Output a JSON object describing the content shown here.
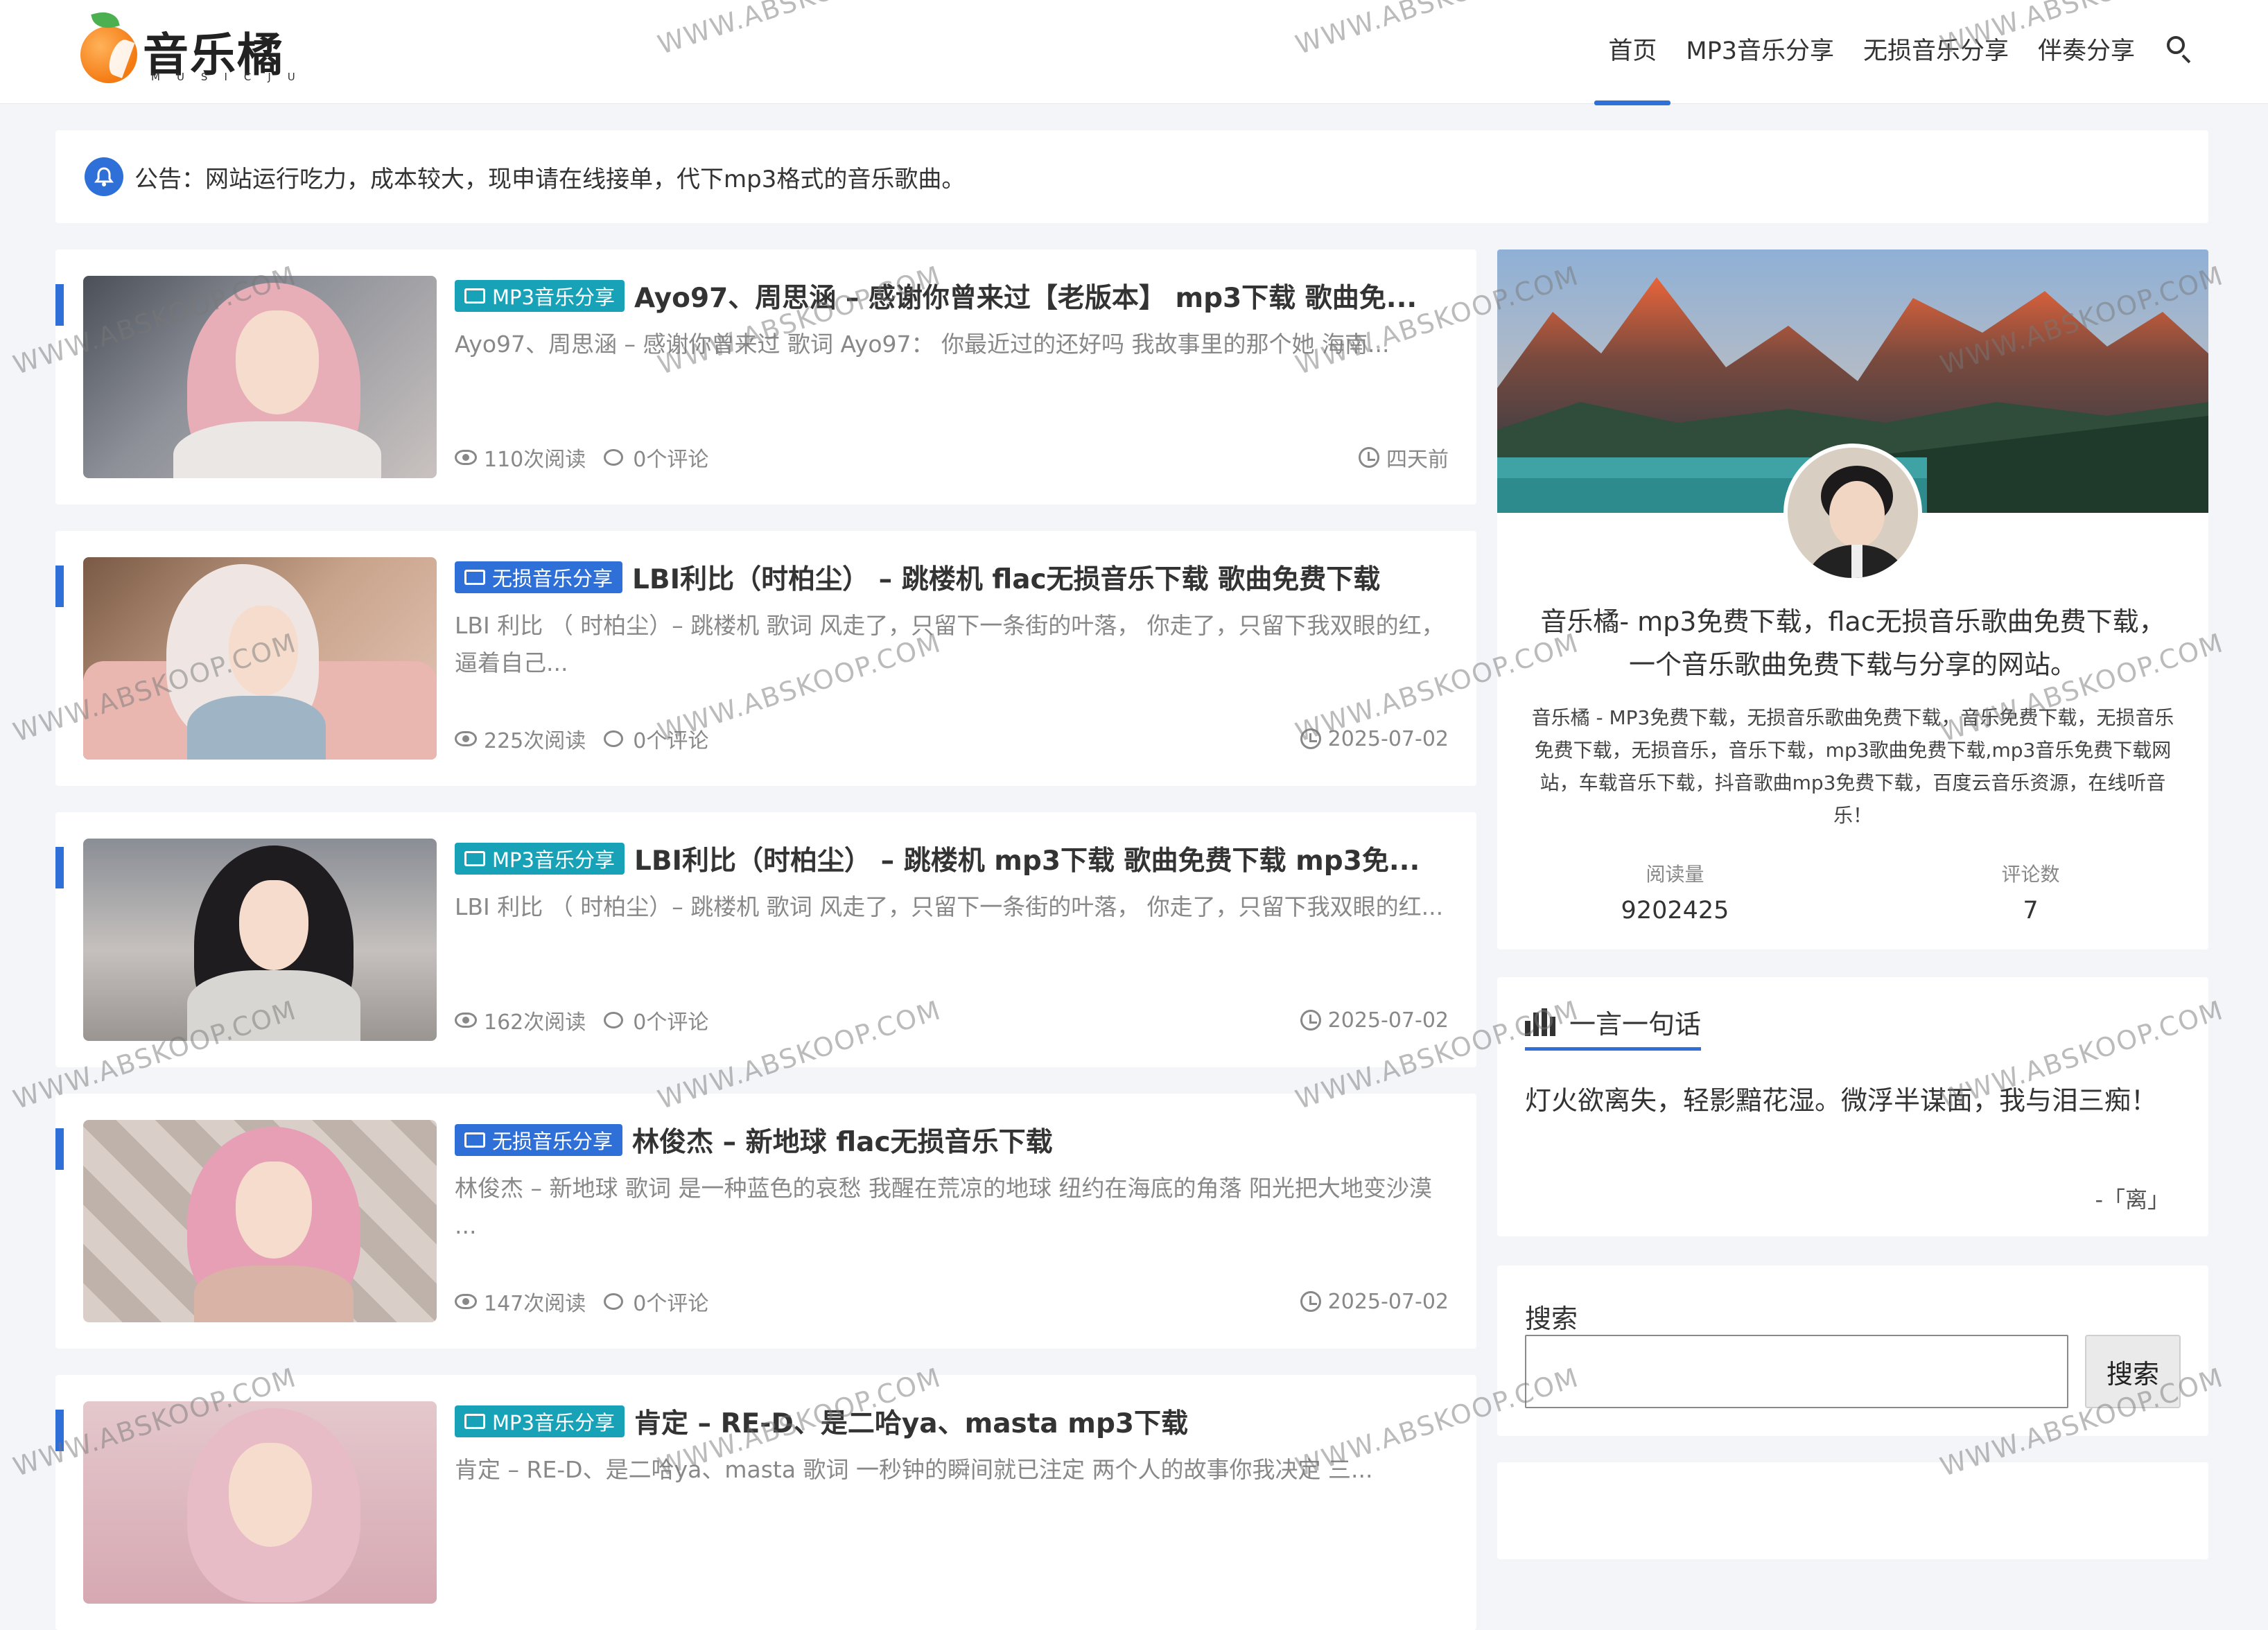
{
  "header": {
    "logo_text": "音乐橘",
    "logo_sub": "MUSICJU",
    "nav": [
      "首页",
      "MP3音乐分享",
      "无损音乐分享",
      "伴奏分享"
    ]
  },
  "notice": {
    "text": "公告：网站运行吃力，成本较大，现申请在线接单，代下mp3格式的音乐歌曲。"
  },
  "posts": [
    {
      "category": "MP3音乐分享",
      "title": "Ayo97、周思涵 – 感谢你曾来过【老版本】 mp3下载 歌曲免...",
      "excerpt": "Ayo97、周思涵 – 感谢你曾来过 歌词 Ayo97： 你最近过的还好吗 我故事里的那个她 海南...",
      "views": "110次阅读",
      "comments": "0个评论",
      "time": "四天前"
    },
    {
      "category": "无损音乐分享",
      "title": "LBI利比（时柏尘） – 跳楼机 flac无损音乐下载 歌曲免费下载",
      "excerpt": "LBI 利比 （ 时柏尘）– 跳楼机 歌词 风走了，只留下一条街的叶落， 你走了，只留下我双眼的红， 逼着自己...",
      "views": "225次阅读",
      "comments": "0个评论",
      "time": "2025-07-02"
    },
    {
      "category": "MP3音乐分享",
      "title": "LBI利比（时柏尘） – 跳楼机 mp3下载 歌曲免费下载 mp3免...",
      "excerpt": "LBI 利比 （ 时柏尘）– 跳楼机 歌词 风走了，只留下一条街的叶落， 你走了，只留下我双眼的红...",
      "views": "162次阅读",
      "comments": "0个评论",
      "time": "2025-07-02"
    },
    {
      "category": "无损音乐分享",
      "title": "林俊杰 – 新地球 flac无损音乐下载",
      "excerpt": "林俊杰 – 新地球 歌词 是一种蓝色的哀愁 我醒在荒凉的地球 纽约在海底的角落 阳光把大地变沙漠 ...",
      "views": "147次阅读",
      "comments": "0个评论",
      "time": "2025-07-02"
    },
    {
      "category": "MP3音乐分享",
      "title": "肯定 – RE-D、是二哈ya、masta mp3下载",
      "excerpt": "肯定 – RE-D、是二哈ya、masta 歌词 一秒钟的瞬间就已注定 两个人的故事你我决定 三...",
      "views": "",
      "comments": "",
      "time": ""
    }
  ],
  "profile": {
    "title": "音乐橘- mp3免费下载，flac无损音乐歌曲免费下载，一个音乐歌曲免费下载与分享的网站。",
    "description": "音乐橘 - MP3免费下载，无损音乐歌曲免费下载，音乐免费下载，无损音乐免费下载，无损音乐，音乐下载，mp3歌曲免费下载,mp3音乐免费下载网站，车载音乐下载，抖音歌曲mp3免费下载，百度云音乐资源，在线听音乐！",
    "stats": [
      {
        "label": "阅读量",
        "value": "9202425"
      },
      {
        "label": "评论数",
        "value": "7"
      }
    ]
  },
  "quote": {
    "title": "一言一句话",
    "text": "灯火欲离失，轻影黯花湿。微浮半谋面，我与泪三痴！",
    "source": "-「离」"
  },
  "search": {
    "label": "搜索",
    "button": "搜索",
    "value": ""
  },
  "watermark": "WWW.ABSKOOP.COM",
  "colors": {
    "accent": "#2f6fd8",
    "mp3_tag": "#17a2b8",
    "flac_tag": "#2f6fd8"
  }
}
